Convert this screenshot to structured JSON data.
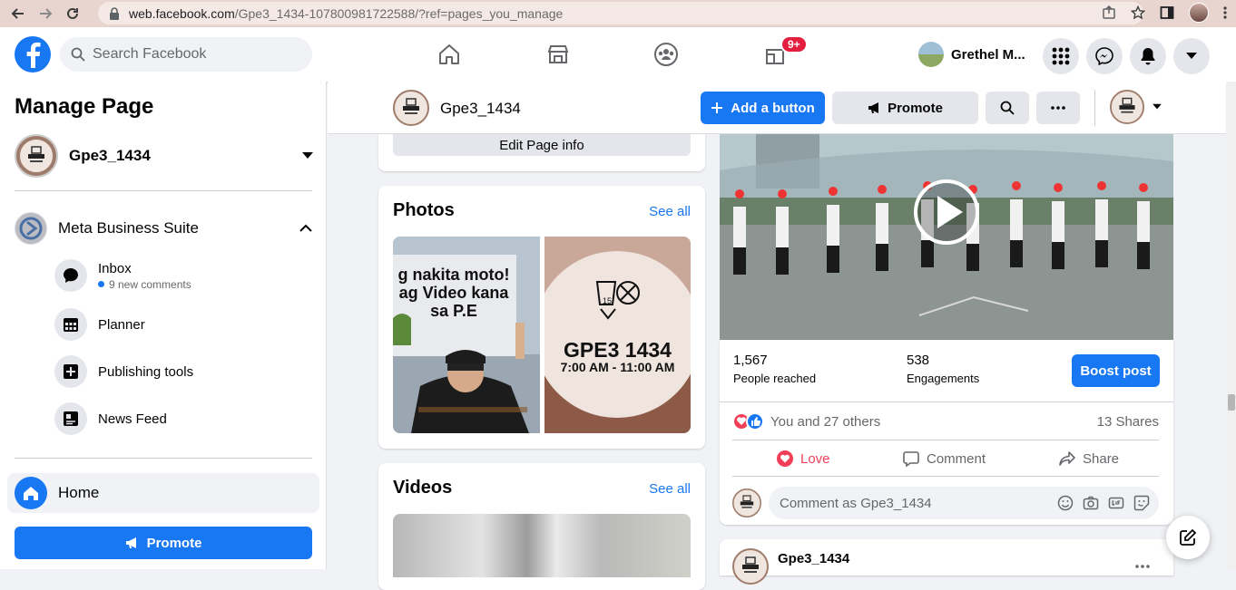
{
  "browser": {
    "url_host": "web.facebook.com",
    "url_path": "/Gpe3_1434-107800981722588/?ref=pages_you_manage"
  },
  "topbar": {
    "search_placeholder": "Search Facebook",
    "notification_badge": "9+",
    "profile_name": "Grethel M..."
  },
  "sidebar": {
    "title": "Manage Page",
    "page_name": "Gpe3_1434",
    "meta_business_suite": "Meta Business Suite",
    "items": [
      {
        "label": "Inbox",
        "meta": "9 new comments"
      },
      {
        "label": "Planner"
      },
      {
        "label": "Publishing tools"
      },
      {
        "label": "News Feed"
      }
    ],
    "home_label": "Home",
    "promote_label": "Promote"
  },
  "pagebar": {
    "page_name": "Gpe3_1434",
    "add_button_label": "Add a button",
    "promote_label": "Promote"
  },
  "left_col": {
    "edit_page_info": "Edit Page info",
    "photos_title": "Photos",
    "photos_see_all": "See all",
    "photo1_text": "g nakita moto!\nag Video kana\nsa P.E",
    "photo2_title": "GPE3 1434",
    "photo2_time": "7:00 AM - 11:00 AM",
    "videos_title": "Videos",
    "videos_see_all": "See all"
  },
  "post": {
    "people_reached_num": "1,567",
    "people_reached_lbl": "People reached",
    "engagements_num": "538",
    "engagements_lbl": "Engagements",
    "boost_label": "Boost post",
    "reactions_text": "You and 27 others",
    "shares_text": "13 Shares",
    "love_label": "Love",
    "comment_label": "Comment",
    "share_label": "Share",
    "comment_placeholder": "Comment as Gpe3_1434",
    "next_post_name": "Gpe3_1434"
  },
  "colors": {
    "brand": "#1877f2",
    "love": "#f33e58",
    "badge": "#e41e3f"
  }
}
